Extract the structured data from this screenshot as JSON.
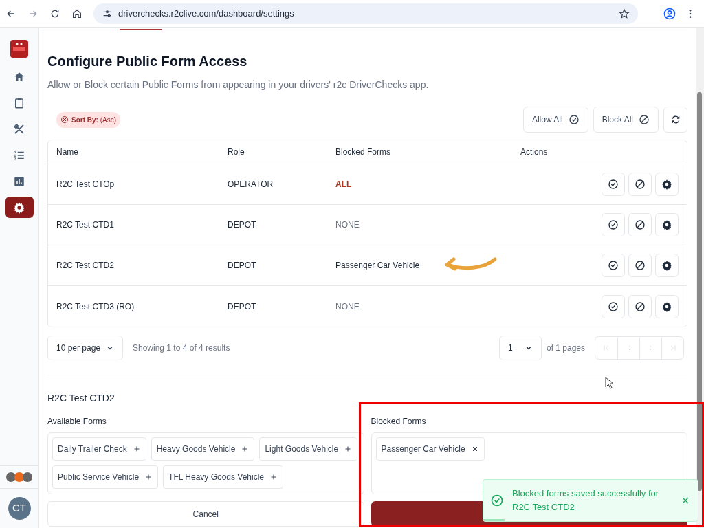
{
  "browser": {
    "url": "driverchecks.r2clive.com/dashboard/settings"
  },
  "sidebar": {
    "items": [
      {
        "kind": "home",
        "selected": false
      },
      {
        "kind": "clipboard",
        "selected": false
      },
      {
        "kind": "tools",
        "selected": false
      },
      {
        "kind": "list",
        "selected": false
      },
      {
        "kind": "chart",
        "selected": false
      },
      {
        "kind": "settings",
        "selected": true
      }
    ],
    "avatar": "CT"
  },
  "page": {
    "title": "Configure Public Form Access",
    "subtitle": "Allow or Block certain Public Forms from appearing in your drivers' r2c DriverChecks app.",
    "sort_chip": "**Sort By:** (Asc)",
    "buttons": [
      "Allow All",
      "Block All"
    ]
  },
  "table": {
    "columns": [
      "Name",
      "Role",
      "Blocked Forms",
      "Actions"
    ],
    "rows": [
      {
        "name": "R2C Test CTOp",
        "role": "OPERATOR",
        "blocked": "ALL",
        "kind": "all"
      },
      {
        "name": "R2C Test CTD1",
        "role": "DEPOT",
        "blocked": "NONE",
        "kind": "none"
      },
      {
        "name": "R2C Test CTD2",
        "role": "DEPOT",
        "blocked": "Passenger Car Vehicle",
        "kind": "list",
        "arrow": true
      },
      {
        "name": "R2C Test CTD3 (RO)",
        "role": "DEPOT",
        "blocked": "NONE",
        "kind": "none"
      }
    ]
  },
  "pagination": {
    "per_page": "10 per page",
    "showing": "Showing 1 to 4 of 4 results",
    "page": "1",
    "of_pages": "of 1 pages"
  },
  "editor": {
    "title": "R2C Test CTD2",
    "available_label": "Available Forms",
    "available": [
      "Daily Trailer Check",
      "Heavy Goods Vehicle",
      "Light Goods Vehicle",
      "Public Service Vehicle",
      "TFL Heavy Goods Vehicle"
    ],
    "blocked_label": "Blocked Forms",
    "blocked": [
      "Passenger Car Vehicle"
    ],
    "cancel": "Cancel"
  },
  "toast": {
    "message": "Blocked forms saved successfully for R2C Test CTD2",
    "level": 0.1
  }
}
